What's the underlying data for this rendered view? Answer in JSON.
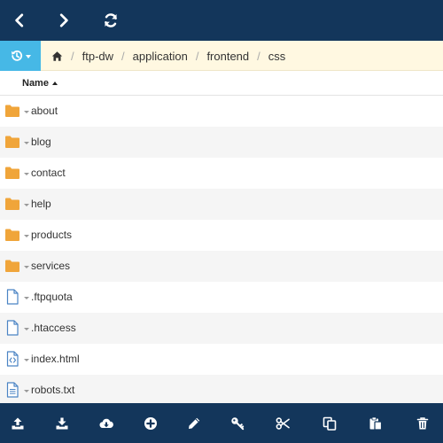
{
  "breadcrumb": [
    "ftp-dw",
    "application",
    "frontend",
    "css"
  ],
  "header": {
    "name_label": "Name",
    "sort": "ascending"
  },
  "files": [
    {
      "name": "about",
      "type": "folder"
    },
    {
      "name": "blog",
      "type": "folder"
    },
    {
      "name": "contact",
      "type": "folder"
    },
    {
      "name": "help",
      "type": "folder"
    },
    {
      "name": "products",
      "type": "folder"
    },
    {
      "name": "services",
      "type": "folder"
    },
    {
      "name": ".ftpquota",
      "type": "file"
    },
    {
      "name": ".htaccess",
      "type": "file"
    },
    {
      "name": "index.html",
      "type": "code"
    },
    {
      "name": "robots.txt",
      "type": "text"
    }
  ],
  "colors": {
    "topbar": "#13365b",
    "history_button": "#46b8e6",
    "pathbar": "#fff8e1",
    "folder": "#f0a53a",
    "file_icon": "#4b84c4"
  },
  "toolbar_icons": [
    "upload-icon",
    "download-icon",
    "cloud-download-icon",
    "add-icon",
    "edit-icon",
    "key-icon",
    "cut-icon",
    "copy-icon",
    "paste-icon",
    "delete-icon"
  ]
}
